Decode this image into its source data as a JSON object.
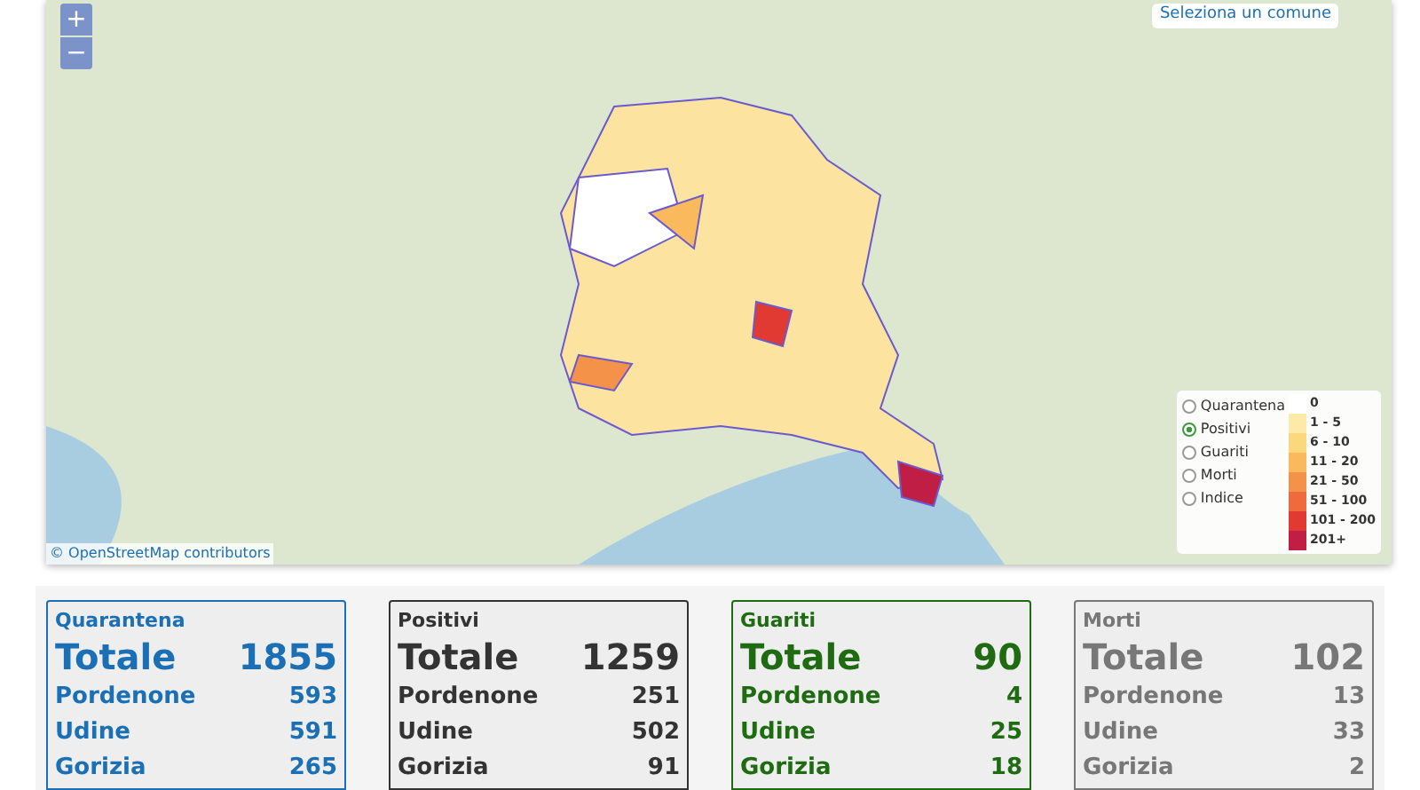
{
  "map": {
    "zoom_in": "+",
    "zoom_out": "−",
    "select_label": "Seleziona un comune",
    "attribution": "© OpenStreetMap contributors",
    "layers": [
      {
        "label": "Quarantena",
        "selected": false
      },
      {
        "label": "Positivi",
        "selected": true
      },
      {
        "label": "Guariti",
        "selected": false
      },
      {
        "label": "Morti",
        "selected": false
      },
      {
        "label": "Indice",
        "selected": false
      }
    ],
    "scale": [
      {
        "label": "0",
        "color": "#ffffff"
      },
      {
        "label": "1 - 5",
        "color": "#fde9a8"
      },
      {
        "label": "6 - 10",
        "color": "#fbd77e"
      },
      {
        "label": "11 - 20",
        "color": "#f9b95c"
      },
      {
        "label": "21 - 50",
        "color": "#f5924a"
      },
      {
        "label": "51 - 100",
        "color": "#ef6a3c"
      },
      {
        "label": "101 - 200",
        "color": "#e03a33"
      },
      {
        "label": "201+",
        "color": "#c01e45"
      }
    ]
  },
  "panels": [
    {
      "title": "Quarantena",
      "color": "#1a6fb5",
      "total_label": "Totale",
      "total": "1855",
      "rows": [
        {
          "name": "Pordenone",
          "value": "593"
        },
        {
          "name": "Udine",
          "value": "591"
        },
        {
          "name": "Gorizia",
          "value": "265"
        }
      ]
    },
    {
      "title": "Positivi",
      "color": "#333333",
      "total_label": "Totale",
      "total": "1259",
      "rows": [
        {
          "name": "Pordenone",
          "value": "251"
        },
        {
          "name": "Udine",
          "value": "502"
        },
        {
          "name": "Gorizia",
          "value": "91"
        }
      ]
    },
    {
      "title": "Guariti",
      "color": "#1e6b12",
      "total_label": "Totale",
      "total": "90",
      "rows": [
        {
          "name": "Pordenone",
          "value": "4"
        },
        {
          "name": "Udine",
          "value": "25"
        },
        {
          "name": "Gorizia",
          "value": "18"
        }
      ]
    },
    {
      "title": "Morti",
      "color": "#777777",
      "total_label": "Totale",
      "total": "102",
      "rows": [
        {
          "name": "Pordenone",
          "value": "13"
        },
        {
          "name": "Udine",
          "value": "33"
        },
        {
          "name": "Gorizia",
          "value": "2"
        }
      ]
    }
  ]
}
